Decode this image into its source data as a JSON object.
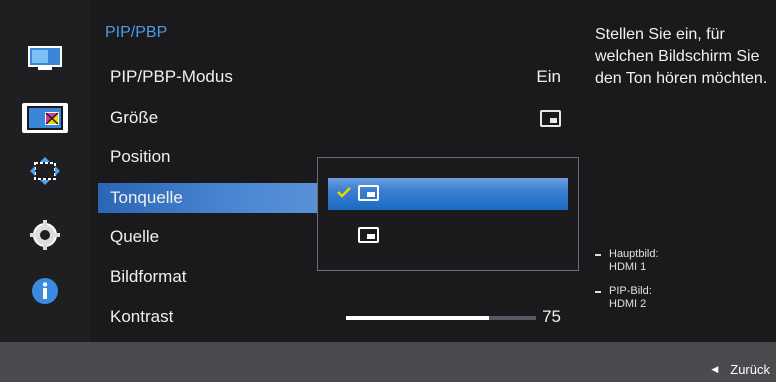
{
  "nav": {
    "icons": [
      "picture-icon",
      "pip-pbp-icon",
      "onscreen-display-icon",
      "system-icon",
      "information-icon"
    ],
    "active_index": 1
  },
  "menu": {
    "title": "PIP/PBP",
    "items": [
      {
        "label": "PIP/PBP-Modus",
        "value": "Ein"
      },
      {
        "label": "Größe",
        "value_icon": "pip-size-icon"
      },
      {
        "label": "Position"
      },
      {
        "label": "Tonquelle",
        "selected": true
      },
      {
        "label": "Quelle"
      },
      {
        "label": "Bildformat"
      },
      {
        "label": "Kontrast",
        "value": "75",
        "level": 0.75
      }
    ]
  },
  "dropdown": {
    "options": [
      {
        "icon": "main-picture-sound-icon",
        "selected": true,
        "check_icon": "checkmark-icon"
      },
      {
        "icon": "sub-picture-sound-icon",
        "selected": false
      }
    ]
  },
  "help": {
    "text": "Stellen Sie ein, für welchen Bildschirm Sie den Ton hören möchten.",
    "info": [
      {
        "line1": "Hauptbild:",
        "line2": "HDMI 1"
      },
      {
        "line1": "PIP-Bild:",
        "line2": "HDMI 2"
      }
    ]
  },
  "footer": {
    "back_label": "Zurück",
    "back_icon": "left-arrow-icon"
  },
  "colors": {
    "accent": "#4d9be8",
    "selection": "#3a7fd0",
    "check": "#e8d900"
  }
}
